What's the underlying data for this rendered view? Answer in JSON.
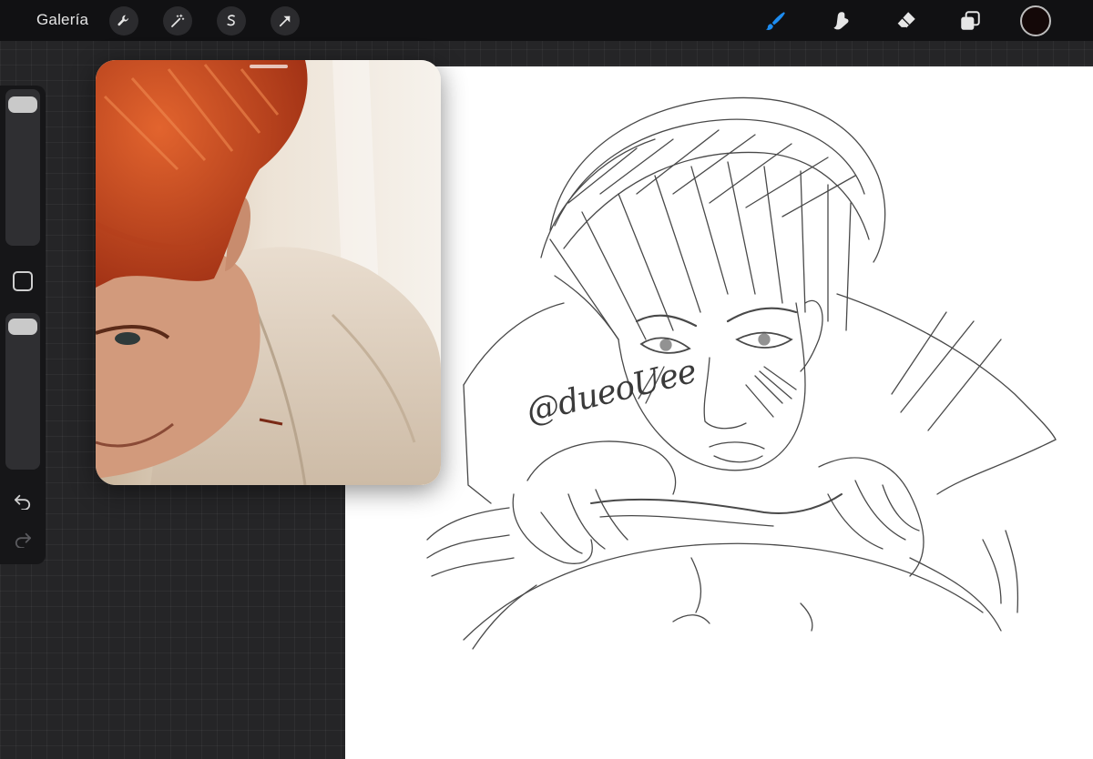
{
  "toolbar": {
    "gallery_label": "Galería",
    "left_tools": [
      {
        "name": "wrench-icon",
        "label": "Actions"
      },
      {
        "name": "magic-wand-icon",
        "label": "Adjustments"
      },
      {
        "name": "selection-icon",
        "label": "Selection"
      },
      {
        "name": "arrow-cursor-icon",
        "label": "Transform"
      }
    ],
    "right_tools": [
      {
        "name": "brush-icon",
        "active": true
      },
      {
        "name": "smudge-icon",
        "active": false
      },
      {
        "name": "eraser-icon",
        "active": false
      },
      {
        "name": "layers-icon",
        "active": false
      }
    ],
    "current_color": "#140808",
    "active_color": "#1d8cf0"
  },
  "sidebar": {
    "brush_size_level": 0.95,
    "opacity_level": 0.95,
    "icons": [
      "modify-square-icon",
      "undo-icon",
      "redo-icon"
    ]
  },
  "canvas": {
    "signature_text": "@dueoUee"
  },
  "reference": {
    "handle": "reference-drag-handle"
  }
}
